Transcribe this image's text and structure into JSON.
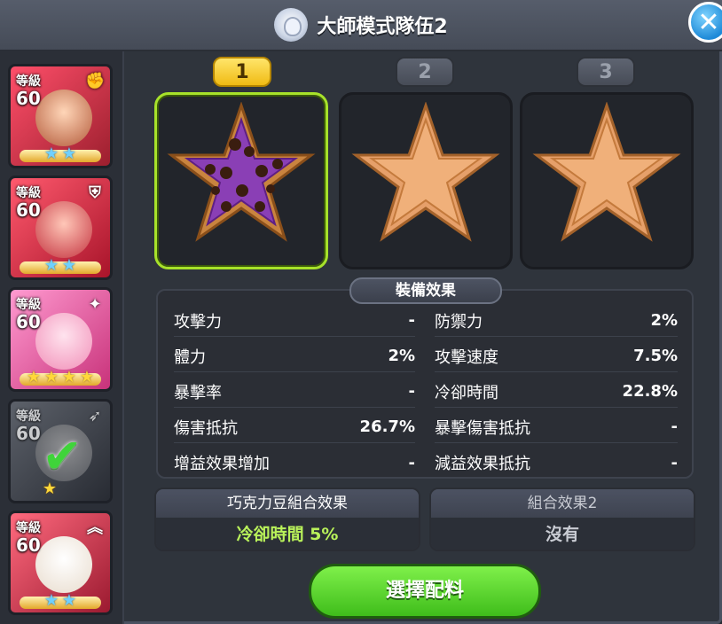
{
  "header": {
    "title": "大師模式隊伍2"
  },
  "characters": [
    {
      "level_label": "等級",
      "level": "60",
      "role_icon": "fist-icon",
      "stars": 2,
      "star_style": "blue",
      "selected": false
    },
    {
      "level_label": "等級",
      "level": "60",
      "role_icon": "shield-icon",
      "stars": 2,
      "star_style": "blue",
      "selected": false
    },
    {
      "level_label": "等級",
      "level": "60",
      "role_icon": "magic-wand-icon",
      "stars": 4,
      "star_style": "gold",
      "selected": false
    },
    {
      "level_label": "等級",
      "level": "60",
      "role_icon": "bow-icon",
      "stars": 1,
      "star_style": "gold",
      "selected": true
    },
    {
      "level_label": "等級",
      "level": "60",
      "role_icon": "double-chevron-up-icon",
      "stars": 2,
      "star_style": "blue",
      "selected": false
    }
  ],
  "slots": [
    {
      "label": "1",
      "active": true,
      "filled": true
    },
    {
      "label": "2",
      "active": false,
      "filled": false
    },
    {
      "label": "3",
      "active": false,
      "filled": false
    }
  ],
  "effects": {
    "header": "裝備效果",
    "stats": [
      {
        "label": "攻擊力",
        "value": "-"
      },
      {
        "label": "防禦力",
        "value": "2%"
      },
      {
        "label": "體力",
        "value": "2%"
      },
      {
        "label": "攻擊速度",
        "value": "7.5%"
      },
      {
        "label": "暴擊率",
        "value": "-"
      },
      {
        "label": "冷卻時間",
        "value": "22.8%"
      },
      {
        "label": "傷害抵抗",
        "value": "26.7%"
      },
      {
        "label": "暴擊傷害抵抗",
        "value": "-"
      },
      {
        "label": "增益效果增加",
        "value": "-"
      },
      {
        "label": "減益效果抵抗",
        "value": "-"
      }
    ]
  },
  "combos": [
    {
      "title": "巧克力豆組合效果",
      "value": "冷卻時間 5%"
    },
    {
      "title": "組合效果2",
      "value": "沒有"
    }
  ],
  "select_button": "選擇配料",
  "colors": {
    "accent_green": "#a7e22a",
    "tab_active": "#f0bb14",
    "button_green": "#3fbd1b"
  }
}
